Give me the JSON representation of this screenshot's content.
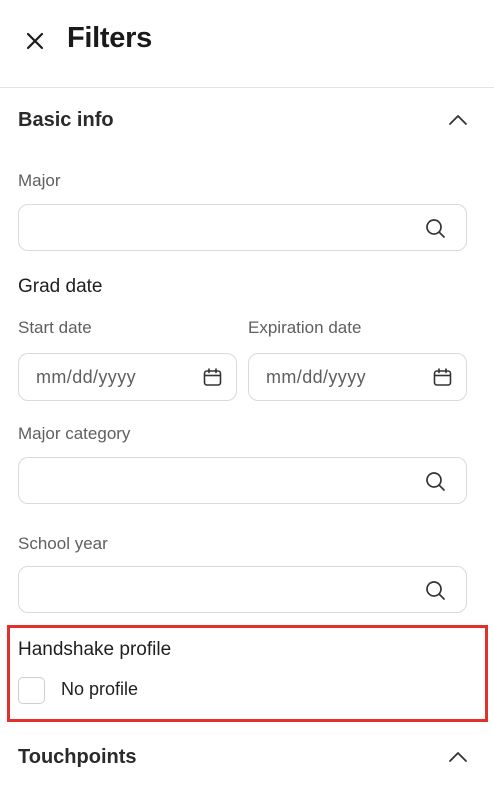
{
  "header": {
    "title": "Filters",
    "close_icon": "close-icon"
  },
  "basic_info": {
    "title": "Basic info",
    "toggle_icon": "chevron-up-icon",
    "major": {
      "label": "Major",
      "value": "",
      "placeholder": ""
    },
    "grad_date": {
      "label": "Grad date",
      "start": {
        "label": "Start date",
        "placeholder": "mm/dd/yyyy"
      },
      "expiration": {
        "label": "Expiration date",
        "placeholder": "mm/dd/yyyy"
      }
    },
    "major_category": {
      "label": "Major category",
      "value": "",
      "placeholder": ""
    },
    "school_year": {
      "label": "School year",
      "value": "",
      "placeholder": ""
    }
  },
  "handshake_profile": {
    "label": "Handshake profile",
    "options": [
      {
        "label": "No profile",
        "checked": false
      }
    ],
    "highlight_color": "#e0322b"
  },
  "touchpoints": {
    "title": "Touchpoints",
    "toggle_icon": "chevron-up-icon"
  }
}
